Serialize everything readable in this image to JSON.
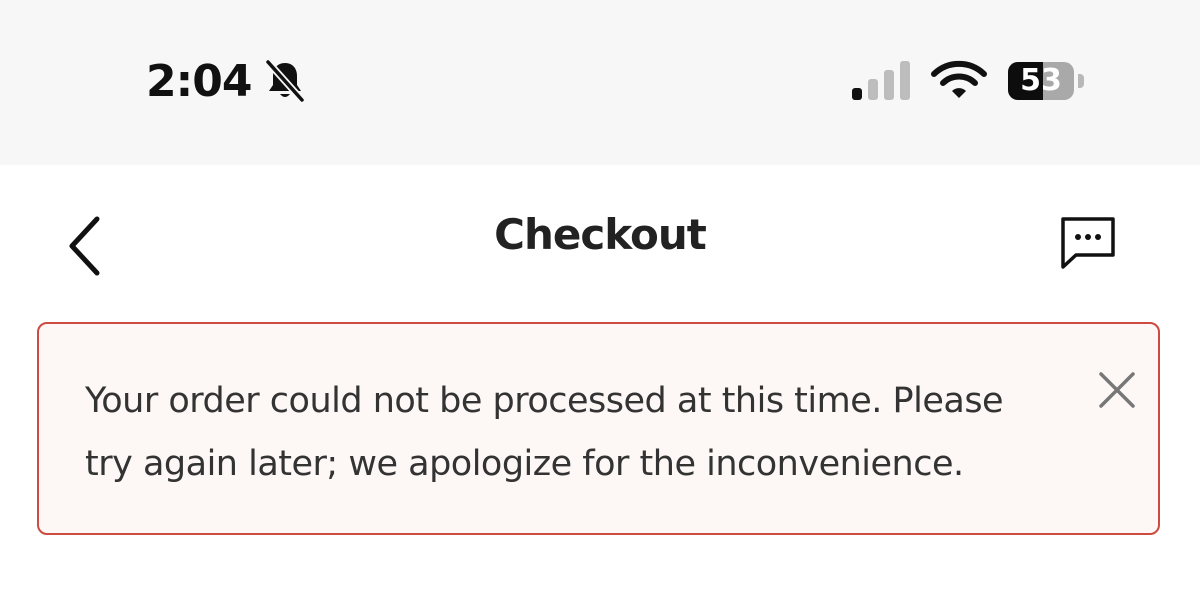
{
  "status_bar": {
    "time": "2:04",
    "battery_level": 53,
    "battery_text": "53",
    "signal_bars": 1,
    "signal_bars_total": 4,
    "silent_mode": true,
    "icons": [
      "bell-slash-icon",
      "cellular-signal-icon",
      "wifi-icon",
      "battery-icon"
    ]
  },
  "header": {
    "title": "Checkout",
    "back_icon": "chevron-left-icon",
    "chat_icon": "chat-bubble-dots-icon"
  },
  "error_banner": {
    "message": "Your order could not be processed at this time. Please try again later; we apologize for the inconvenience.",
    "close_icon": "close-icon",
    "border_color": "#cf4a40",
    "background_color": "#fdf7f6"
  }
}
